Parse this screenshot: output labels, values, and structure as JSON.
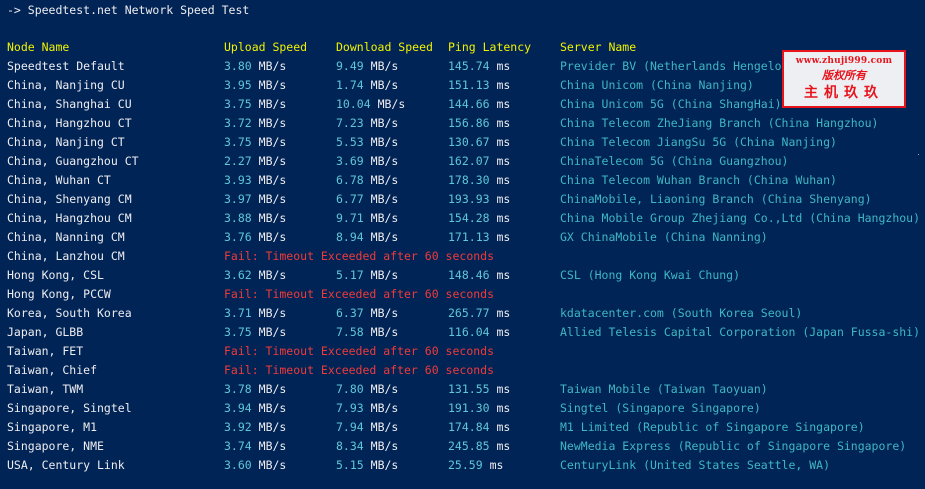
{
  "title_line": "-> Speedtest.net Network Speed Test",
  "headers": {
    "node": "Node Name",
    "upload": "Upload Speed",
    "download": "Download Speed",
    "ping": "Ping Latency",
    "server": "Server Name"
  },
  "unit_speed": "MB/s",
  "unit_ping": "ms",
  "rows": [
    {
      "node": "Speedtest Default",
      "up": "3.80",
      "down": "9.49",
      "ping": "145.74",
      "server": "Previder BV (Netherlands Hengelo)"
    },
    {
      "node": "China, Nanjing CU",
      "up": "3.95",
      "down": "1.74",
      "ping": "151.13",
      "server": "China Unicom (China Nanjing)"
    },
    {
      "node": "China, Shanghai CU",
      "up": "3.75",
      "down": "10.04",
      "ping": "144.66",
      "server": "China Unicom 5G (China ShangHai)"
    },
    {
      "node": "China, Hangzhou CT",
      "up": "3.72",
      "down": "7.23",
      "ping": "156.86",
      "server": "China Telecom ZheJiang Branch (China Hangzhou)"
    },
    {
      "node": "China, Nanjing CT",
      "up": "3.75",
      "down": "5.53",
      "ping": "130.67",
      "server": "China Telecom JiangSu 5G (China Nanjing)"
    },
    {
      "node": "China, Guangzhou CT",
      "up": "2.27",
      "down": "3.69",
      "ping": "162.07",
      "server": "ChinaTelecom 5G (China Guangzhou)"
    },
    {
      "node": "China, Wuhan CT",
      "up": "3.93",
      "down": "6.78",
      "ping": "178.30",
      "server": "China Telecom Wuhan Branch (China Wuhan)"
    },
    {
      "node": "China, Shenyang CM",
      "up": "3.97",
      "down": "6.77",
      "ping": "193.93",
      "server": "ChinaMobile, Liaoning Branch (China Shenyang)"
    },
    {
      "node": "China, Hangzhou CM",
      "up": "3.88",
      "down": "9.71",
      "ping": "154.28",
      "server": "China Mobile Group Zhejiang Co.,Ltd (China Hangzhou)"
    },
    {
      "node": "China, Nanning CM",
      "up": "3.76",
      "down": "8.94",
      "ping": "171.13",
      "server": "GX ChinaMobile (China Nanning)"
    },
    {
      "node": "China, Lanzhou CM",
      "fail": "Fail: Timeout Exceeded after 60 seconds"
    },
    {
      "node": "Hong Kong, CSL",
      "up": "3.62",
      "down": "5.17",
      "ping": "148.46",
      "server": "CSL (Hong Kong Kwai Chung)"
    },
    {
      "node": "Hong Kong, PCCW",
      "fail": "Fail: Timeout Exceeded after 60 seconds"
    },
    {
      "node": "Korea, South Korea",
      "up": "3.71",
      "down": "6.37",
      "ping": "265.77",
      "server": "kdatacenter.com (South Korea Seoul)"
    },
    {
      "node": "Japan, GLBB",
      "up": "3.75",
      "down": "7.58",
      "ping": "116.04",
      "server": "Allied Telesis Capital Corporation (Japan Fussa-shi)"
    },
    {
      "node": "Taiwan, FET",
      "fail": "Fail: Timeout Exceeded after 60 seconds"
    },
    {
      "node": "Taiwan, Chief",
      "fail": "Fail: Timeout Exceeded after 60 seconds"
    },
    {
      "node": "Taiwan, TWM",
      "up": "3.78",
      "down": "7.80",
      "ping": "131.55",
      "server": "Taiwan Mobile (Taiwan Taoyuan)"
    },
    {
      "node": "Singapore, Singtel",
      "up": "3.94",
      "down": "7.93",
      "ping": "191.30",
      "server": "Singtel (Singapore Singapore)"
    },
    {
      "node": "Singapore, M1",
      "up": "3.92",
      "down": "7.94",
      "ping": "174.84",
      "server": "M1 Limited (Republic of Singapore Singapore)"
    },
    {
      "node": "Singapore, NME",
      "up": "3.74",
      "down": "8.34",
      "ping": "245.85",
      "server": "NewMedia Express (Republic of Singapore Singapore)"
    },
    {
      "node": "USA, Century Link",
      "up": "3.60",
      "down": "5.15",
      "ping": "25.59",
      "server": "CenturyLink (United States Seattle, WA)"
    }
  ],
  "watermark": {
    "url": "www.zhuji999.com",
    "copyright": "版权所有",
    "name": "主机玖玖"
  },
  "colors": {
    "background": "#012456",
    "header": "#f2f200",
    "text": "#eeedf0",
    "number": "#5fc7d8",
    "server": "#3fb7c4",
    "fail": "#f03a3a",
    "watermark": "#e8141c"
  }
}
